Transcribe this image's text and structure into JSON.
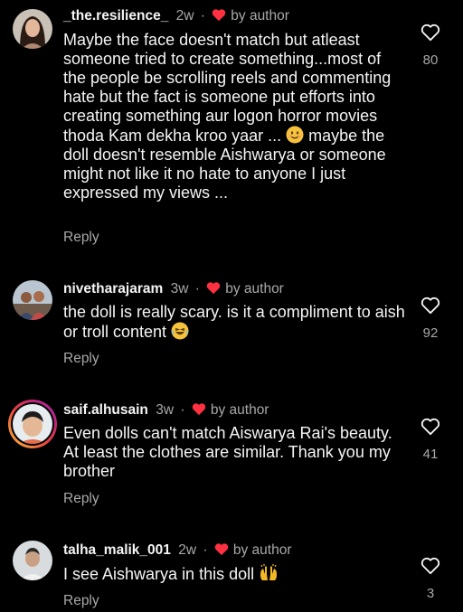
{
  "author_label": "by author",
  "reply_label": "Reply",
  "colors": {
    "background": "#000000",
    "text": "#f5f5f5",
    "secondary": "#a8a8a8",
    "author_heart": "#ff3040"
  },
  "comments": [
    {
      "username": "_the.resilience_",
      "time": "2w",
      "text_part1": "Maybe the face doesn't match but atleast someone tried to create something...most of the people be scrolling reels and commenting hate but the fact is someone put efforts into creating something aur logon horror movies thoda Kam dekha kroo yaar ... ",
      "emoji": "smiling-face-icon",
      "text_part2": " maybe the doll doesn't resemble Aishwarya or someone might not like it no hate to anyone I just expressed my views ...",
      "likes": "80"
    },
    {
      "username": "nivetharajaram",
      "time": "3w",
      "text_part1": "the doll is really scary. is it a compliment to aish or troll content ",
      "emoji": "laughing-face-icon",
      "text_part2": "",
      "likes": "92"
    },
    {
      "username": "saif.alhusain",
      "time": "3w",
      "text_part1": "Even dolls can't match Aiswarya Rai's beauty. At least the clothes are similar. Thank you my brother",
      "emoji": "",
      "text_part2": "",
      "likes": "41"
    },
    {
      "username": "talha_malik_001",
      "time": "2w",
      "text_part1": "I see Aishwarya in this doll ",
      "emoji": "raising-hands-icon",
      "text_part2": "",
      "likes": "3"
    }
  ]
}
